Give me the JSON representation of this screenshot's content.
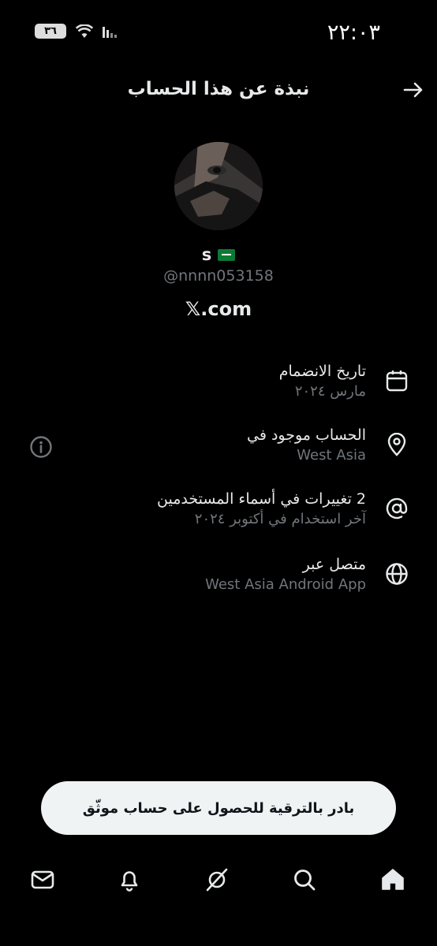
{
  "status_bar": {
    "time": "٢٢:٠٣",
    "battery": "٣٦",
    "icons": [
      "battery-icon",
      "wifi-icon",
      "signal-icon"
    ]
  },
  "header": {
    "title": "نبذة عن هذا الحساب",
    "back_icon": "arrow-right-icon"
  },
  "profile": {
    "display_name": "s",
    "flag": "saudi-flag-icon",
    "handle": "@nnnn053158",
    "site": "𝕏.com"
  },
  "info_rows": [
    {
      "icon": "calendar-icon",
      "title": "تاريخ الانضمام",
      "subtitle": "مارس ٢٠٢٤"
    },
    {
      "icon": "location-pin-icon",
      "title": "الحساب موجود في",
      "subtitle": "West Asia"
    },
    {
      "icon": "at-sign-icon",
      "title": "2 تغييرات في أسماء المستخدمين",
      "subtitle": "آخر استخدام في أكتوبر ٢٠٢٤"
    },
    {
      "icon": "globe-icon",
      "title": "متصل عبر",
      "subtitle": "West Asia Android App"
    }
  ],
  "upgrade_button": "بادر بالترقية للحصول على حساب موثّق",
  "bottom_nav": [
    "home-icon",
    "search-icon",
    "grok-icon",
    "notifications-icon",
    "messages-icon"
  ],
  "colors": {
    "background": "#000000",
    "primary_text": "#e7e9ea",
    "secondary_text": "#71767b",
    "button_bg": "#eff3f4"
  }
}
